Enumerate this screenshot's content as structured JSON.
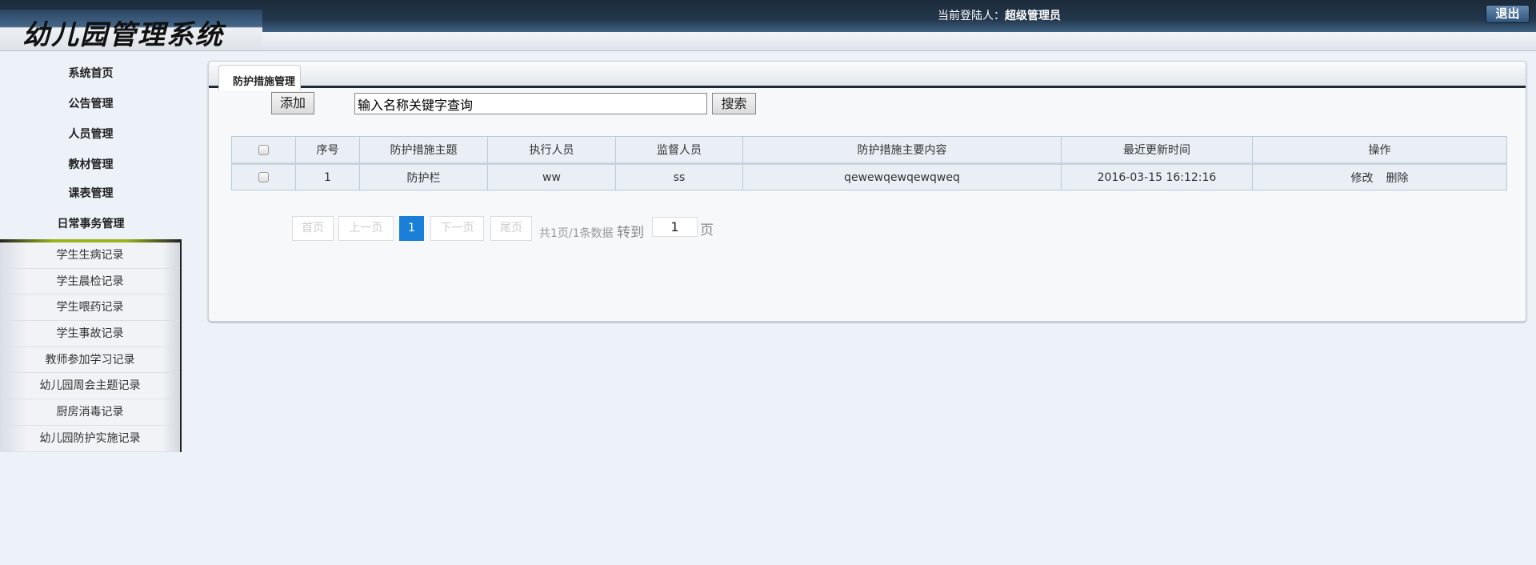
{
  "header": {
    "logo": "幼儿园管理系统",
    "user_label": "当前登陆人：",
    "user_name": "超级管理员",
    "logout": "退出"
  },
  "sidebar": {
    "items": [
      "系统首页",
      "公告管理",
      "人员管理",
      "教材管理",
      "课表管理",
      "日常事务管理"
    ],
    "subitems": [
      "学生生病记录",
      "学生晨检记录",
      "学生喂药记录",
      "学生事故记录",
      "教师参加学习记录",
      "幼儿园周会主题记录",
      "厨房消毒记录",
      "幼儿园防护实施记录"
    ]
  },
  "main": {
    "tab": "防护措施管理",
    "add": "添加",
    "search_value": "输入名称关键字查询",
    "search": "搜索",
    "columns": [
      "序号",
      "防护措施主题",
      "执行人员",
      "监督人员",
      "防护措施主要内容",
      "最近更新时间",
      "操作"
    ],
    "rows": [
      {
        "no": "1",
        "topic": "防护栏",
        "executor": "ww",
        "supervisor": "ss",
        "content": "qewewqewqewqweq",
        "updated": "2016-03-15 16:12:16",
        "edit": "修改",
        "delete": "删除"
      }
    ],
    "pager": {
      "first": "首页",
      "prev": "上一页",
      "current": "1",
      "next": "下一页",
      "last": "尾页",
      "summary": "共1页/1条数据",
      "goto": "转到",
      "goto_value": "1",
      "page_unit": "页"
    }
  }
}
